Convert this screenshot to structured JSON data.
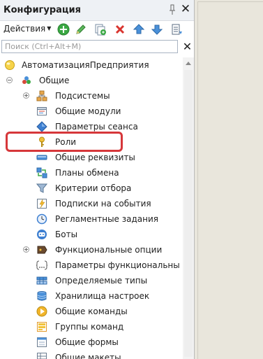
{
  "panel": {
    "title": "Конфигурация",
    "pin_glyph": "ꟷ",
    "close_glyph": "✕"
  },
  "toolbar": {
    "actions_label": "Действия",
    "icons": [
      "add-icon",
      "edit-icon",
      "copy-add-icon",
      "delete-icon",
      "move-up-icon",
      "move-down-icon",
      "sort-list-icon"
    ]
  },
  "search": {
    "placeholder": "Поиск (Ctrl+Alt+M)",
    "value": "",
    "clear_glyph": "✕"
  },
  "tree": {
    "root": {
      "label": "АвтоматизацияПредприятия",
      "icon": "configuration-root-icon"
    },
    "group": {
      "label": "Общие",
      "icon": "common-group-icon",
      "expanded": true
    },
    "items": [
      {
        "label": "Подсистемы",
        "icon": "subsystems-icon",
        "expandable": true
      },
      {
        "label": "Общие модули",
        "icon": "common-modules-icon",
        "expandable": false
      },
      {
        "label": "Параметры сеанса",
        "icon": "session-params-icon",
        "expandable": false
      },
      {
        "label": "Роли",
        "icon": "roles-icon",
        "expandable": false
      },
      {
        "label": "Общие реквизиты",
        "icon": "common-attributes-icon",
        "expandable": false
      },
      {
        "label": "Планы обмена",
        "icon": "exchange-plans-icon",
        "expandable": false
      },
      {
        "label": "Критерии отбора",
        "icon": "filter-criteria-icon",
        "expandable": false
      },
      {
        "label": "Подписки на события",
        "icon": "event-subscriptions-icon",
        "expandable": false
      },
      {
        "label": "Регламентные задания",
        "icon": "scheduled-jobs-icon",
        "expandable": false
      },
      {
        "label": "Боты",
        "icon": "bots-icon",
        "expandable": false
      },
      {
        "label": "Функциональные опции",
        "icon": "functional-options-icon",
        "expandable": true
      },
      {
        "label": "Параметры функциональны",
        "icon": "functional-params-icon",
        "expandable": false
      },
      {
        "label": "Определяемые типы",
        "icon": "defined-types-icon",
        "expandable": false
      },
      {
        "label": "Хранилища настроек",
        "icon": "settings-storages-icon",
        "expandable": false
      },
      {
        "label": "Общие команды",
        "icon": "common-commands-icon",
        "expandable": false
      },
      {
        "label": "Группы команд",
        "icon": "command-groups-icon",
        "expandable": false
      },
      {
        "label": "Общие формы",
        "icon": "common-forms-icon",
        "expandable": false
      },
      {
        "label": "Общие макеты",
        "icon": "common-templates-icon",
        "expandable": false
      }
    ],
    "highlighted_item": "Роли"
  },
  "colors": {
    "highlight_border": "#d6373a",
    "panel_title_bg": "#eef1f5",
    "right_area_bg": "#e9e6dc"
  }
}
